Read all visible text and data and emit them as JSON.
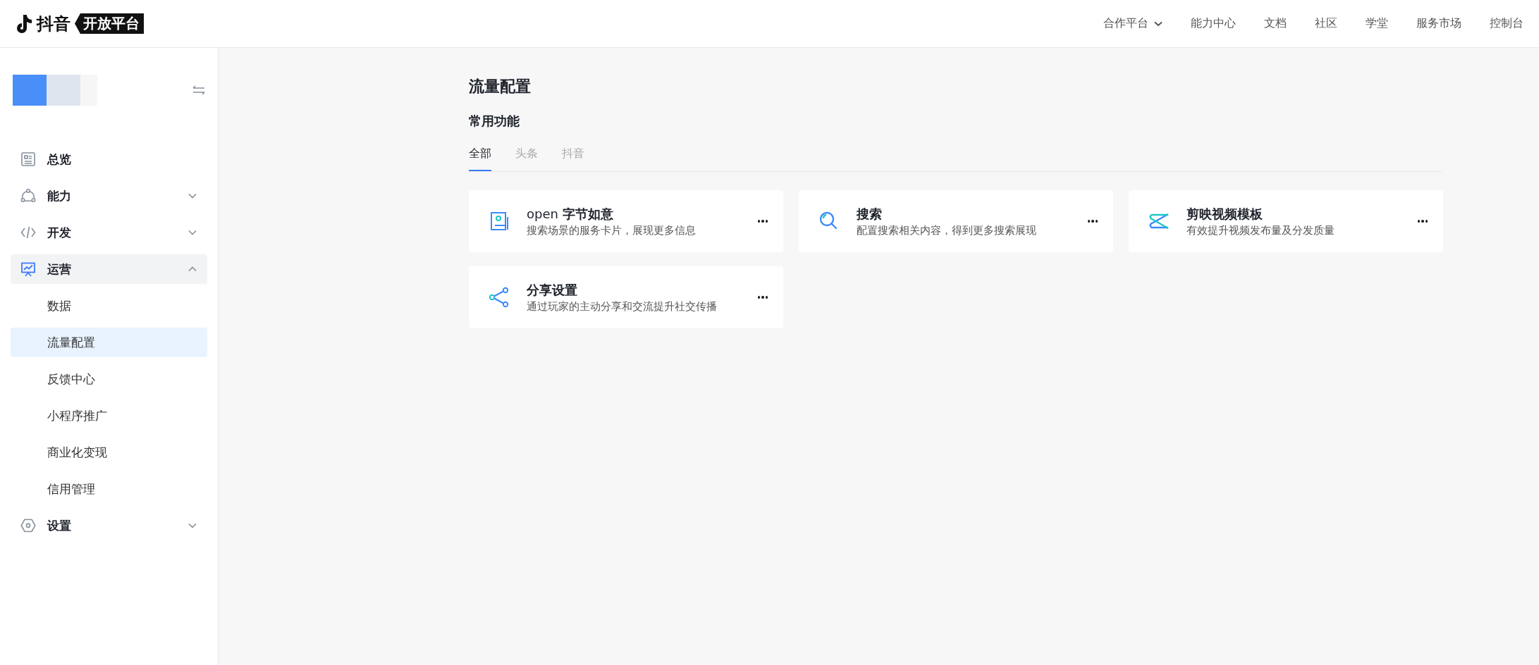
{
  "header": {
    "logo": {
      "brand": "抖音",
      "tag": "开放平台"
    },
    "nav": [
      {
        "label": "合作平台",
        "kind": "dropdown"
      },
      {
        "label": "能力中心",
        "kind": "link"
      },
      {
        "label": "文档",
        "kind": "link"
      },
      {
        "label": "社区",
        "kind": "link"
      },
      {
        "label": "学堂",
        "kind": "link"
      },
      {
        "label": "服务市场",
        "kind": "link"
      },
      {
        "label": "控制台",
        "kind": "link"
      }
    ]
  },
  "sidebar": {
    "items": [
      {
        "label": "总览",
        "kind": "link",
        "selected": false
      },
      {
        "label": "能力",
        "kind": "group",
        "expanded": false,
        "selected": false
      },
      {
        "label": "开发",
        "kind": "group",
        "expanded": false,
        "selected": false
      },
      {
        "label": "运营",
        "kind": "group",
        "expanded": true,
        "selected": true,
        "children": [
          {
            "label": "数据",
            "selected": false
          },
          {
            "label": "流量配置",
            "selected": true
          },
          {
            "label": "反馈中心",
            "selected": false
          },
          {
            "label": "小程序推广",
            "selected": false
          },
          {
            "label": "商业化变现",
            "selected": false
          },
          {
            "label": "信用管理",
            "selected": false
          }
        ]
      },
      {
        "label": "设置",
        "kind": "group",
        "expanded": false,
        "selected": false
      }
    ]
  },
  "page": {
    "title": "流量配置",
    "section": "常用功能",
    "tabs": [
      {
        "label": "全部",
        "selected": true
      },
      {
        "label": "头条",
        "selected": false
      },
      {
        "label": "抖音",
        "selected": false
      }
    ],
    "cards": [
      {
        "title": "open **字节如意**",
        "description": "搜索场景的服务卡片，展现更多信息"
      },
      {
        "title": "搜索",
        "description": "配置搜索相关内容，得到更多搜索展现"
      },
      {
        "title": "剪映视频模板",
        "description": "有效提升视频发布量及分发质量"
      },
      {
        "title": "分享设置",
        "description": "通过玩家的主动分享和交流提升社交传播"
      }
    ]
  }
}
